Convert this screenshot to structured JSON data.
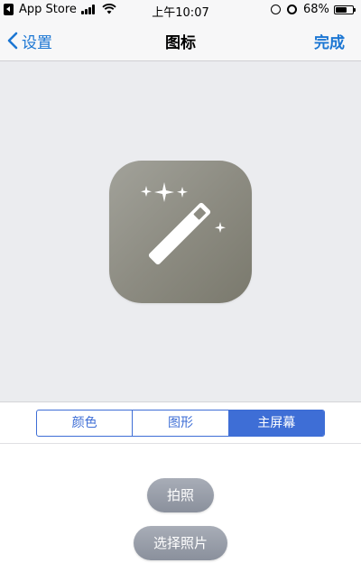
{
  "status_bar": {
    "back_app": "App Store",
    "time": "上午10:07",
    "battery_percent": "68%",
    "battery_level": 0.68,
    "icons": [
      "back-to-app-icon",
      "signal-icon",
      "wifi-icon",
      "orientation-lock-icon",
      "alarm-icon",
      "battery-icon"
    ]
  },
  "nav": {
    "back_label": "设置",
    "title": "图标",
    "done_label": "完成"
  },
  "preview": {
    "icon": "magic-wand-icon",
    "icon_background": "#8d8c82"
  },
  "segments": {
    "items": [
      {
        "label": "颜色",
        "active": false
      },
      {
        "label": "图形",
        "active": false
      },
      {
        "label": "主屏幕",
        "active": true
      }
    ],
    "accent": "#3e6ed6"
  },
  "actions": {
    "take_photo": "拍照",
    "choose_photo": "选择照片"
  }
}
